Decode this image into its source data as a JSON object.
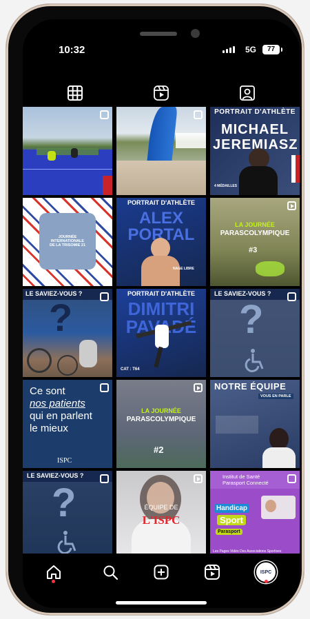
{
  "status": {
    "time": "10:32",
    "network": "5G",
    "battery": "77"
  },
  "tabs": [
    {
      "icon": "grid-icon",
      "active": true
    },
    {
      "icon": "reels-icon",
      "active": false
    },
    {
      "icon": "tagged-icon",
      "active": false
    }
  ],
  "posts": {
    "p3": {
      "title": "PORTRAIT D'ATHLÈTE",
      "name": "MICHAEL JEREMIASZ",
      "sub": "4 MÉDAILLES"
    },
    "p4": {
      "line1": "JOURNÉE",
      "line2": "INTERNATIONALE",
      "line3": "DE LA TRISOMIE 21"
    },
    "p5": {
      "title": "PORTRAIT D'ATHLÈTE",
      "name": "ALEX PORTAL",
      "sub": "NAGE LIBRE"
    },
    "p6": {
      "line1": "LA JOURNÉE",
      "line2": "PARASCOLYMPIQUE",
      "num": "#3"
    },
    "p7": {
      "title": "LE SAVIEZ-VOUS ?"
    },
    "p8": {
      "title": "PORTRAIT D'ATHLÈTE",
      "name": "DIMITRI PAVADÉ",
      "sub": "CAT : T64"
    },
    "p9": {
      "title": "LE SAVIEZ-VOUS ?"
    },
    "p10": {
      "line1": "Ce sont",
      "line2": "nos patients",
      "line3": "qui en parlent",
      "line4": "le mieux",
      "logo": "ISPC"
    },
    "p11": {
      "line1": "LA JOURNÉE",
      "line2": "PARASCOLYMPIQUE",
      "num": "#2"
    },
    "p12": {
      "title": "NOTRE ÉQUIPE",
      "tag": "VOUS EN PARLE"
    },
    "p13": {
      "title": "LE SAVIEZ-VOUS ?"
    },
    "p14": {
      "line1": "ÉQUIPE DE",
      "line2": "L'ISPC"
    },
    "p15": {
      "line1": "Institut de Santé",
      "line2": "Parasport Connecté",
      "badge1": "Handicap",
      "badge2": "Sport",
      "badge3": "Parasport",
      "footer": "Les Pages Vidéo Des Associations Sportives"
    }
  },
  "bottom_nav": [
    {
      "icon": "home-icon",
      "notify": true
    },
    {
      "icon": "search-icon",
      "notify": false
    },
    {
      "icon": "create-icon",
      "notify": false
    },
    {
      "icon": "reels-icon",
      "notify": false
    },
    {
      "icon": "profile-avatar",
      "label": "ISPC",
      "notify": true
    }
  ],
  "colors": {
    "accent": "#ff3040",
    "navy": "#16284f",
    "purple": "#9b4dc9",
    "ispc_red": "#e3262c"
  }
}
